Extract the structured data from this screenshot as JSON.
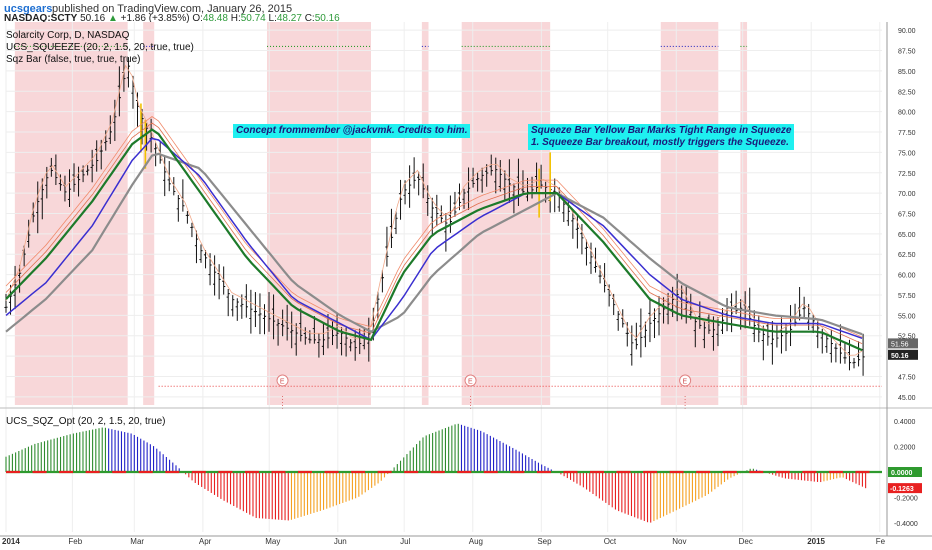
{
  "header": {
    "publisher": "ucsgears",
    "published_text": "published on TradingView.com, January 26, 2015"
  },
  "quote": {
    "symbol": "NASDAQ:SCTY",
    "last": "50.16",
    "arrow": "▲",
    "change": "+1.86 (+3.85%)",
    "o_label": "O:",
    "o": "48.48",
    "h_label": "H:",
    "h": "50.74",
    "l_label": "L:",
    "l": "48.27",
    "c_label": "C:",
    "c": "50.16"
  },
  "overlays": {
    "title": "Solarcity Corp, D, NASDAQ",
    "indicator1": "UCS_SQUEEZE (20, 2, 1.5, 20, true, true)",
    "indicator2": "Sqz Bar (false, true, true, true)",
    "indicator3": "UCS_SQZ_Opt (20, 2, 1.5, 20, true)"
  },
  "annotations": {
    "a1": "Concept frommember @jackvmk. Credits to him.",
    "a2": "Squeeze Bar Yellow Bar Marks Tight Range in Squeeze\n1. Squeeze Bar breakout, mostly triggers the Squeeze."
  },
  "colors": {
    "squeeze_band": "#f8d7d9",
    "ema_green": "#1d7a2a",
    "ema_blue": "#3a2fd0",
    "ema_gray": "#8c8c8c",
    "osc_green": "#2e8b2e",
    "osc_blue": "#2020c8",
    "osc_red": "#e82020",
    "osc_orange": "#f5a020",
    "last_price_bg": "#222222",
    "mom_label_bg": "#2e9a2e",
    "neg_label_bg": "#e82020"
  },
  "chart_data": {
    "type": "candlestick",
    "y_ticks": [
      "90.00",
      "87.50",
      "85.00",
      "82.50",
      "80.00",
      "77.50",
      "75.00",
      "72.50",
      "70.00",
      "67.50",
      "65.00",
      "62.50",
      "60.00",
      "57.50",
      "55.00",
      "52.50",
      "50.00",
      "47.50",
      "45.00"
    ],
    "ylim": [
      44.0,
      91.0
    ],
    "x_ticks": [
      "2014",
      "Feb",
      "Mar",
      "Apr",
      "May",
      "Jun",
      "Jul",
      "Aug",
      "Sep",
      "Oct",
      "Nov",
      "Dec",
      "2015",
      "Fe"
    ],
    "last_price": "50.16",
    "prev_marker": "51.56",
    "squeeze_periods": [
      [
        "2014-01-06",
        "2014-02-26"
      ],
      [
        "2014-03-05",
        "2014-03-10"
      ],
      [
        "2014-04-30",
        "2014-06-16"
      ],
      [
        "2014-07-09",
        "2014-07-12"
      ],
      [
        "2014-07-27",
        "2014-09-05"
      ],
      [
        "2014-10-25",
        "2014-11-20"
      ],
      [
        "2014-11-30",
        "2014-12-03"
      ]
    ],
    "earnings_markers": [
      "2014-05-07",
      "2014-07-31",
      "2014-11-05"
    ],
    "close_path": [
      [
        "2014-01-02",
        56.0
      ],
      [
        "2014-01-08",
        60.0
      ],
      [
        "2014-01-15",
        68.0
      ],
      [
        "2014-01-22",
        73.0
      ],
      [
        "2014-01-29",
        70.0
      ],
      [
        "2014-02-05",
        72.0
      ],
      [
        "2014-02-12",
        74.0
      ],
      [
        "2014-02-19",
        78.0
      ],
      [
        "2014-02-26",
        86.0
      ],
      [
        "2014-03-03",
        80.0
      ],
      [
        "2014-03-10",
        76.0
      ],
      [
        "2014-03-17",
        71.0
      ],
      [
        "2014-03-24",
        68.0
      ],
      [
        "2014-03-31",
        63.0
      ],
      [
        "2014-04-07",
        60.0
      ],
      [
        "2014-04-14",
        57.0
      ],
      [
        "2014-04-21",
        56.0
      ],
      [
        "2014-04-28",
        55.0
      ],
      [
        "2014-05-05",
        54.0
      ],
      [
        "2014-05-12",
        53.0
      ],
      [
        "2014-05-19",
        52.0
      ],
      [
        "2014-05-26",
        52.0
      ],
      [
        "2014-06-02",
        53.0
      ],
      [
        "2014-06-09",
        51.0
      ],
      [
        "2014-06-16",
        53.0
      ],
      [
        "2014-06-23",
        62.0
      ],
      [
        "2014-06-30",
        70.0
      ],
      [
        "2014-07-07",
        72.0
      ],
      [
        "2014-07-14",
        68.0
      ],
      [
        "2014-07-21",
        66.0
      ],
      [
        "2014-07-28",
        70.0
      ],
      [
        "2014-08-04",
        72.0
      ],
      [
        "2014-08-11",
        73.0
      ],
      [
        "2014-08-18",
        71.0
      ],
      [
        "2014-08-25",
        70.0
      ],
      [
        "2014-09-01",
        71.0
      ],
      [
        "2014-09-08",
        70.0
      ],
      [
        "2014-09-15",
        67.0
      ],
      [
        "2014-09-22",
        63.0
      ],
      [
        "2014-09-29",
        59.0
      ],
      [
        "2014-10-06",
        55.0
      ],
      [
        "2014-10-13",
        51.0
      ],
      [
        "2014-10-20",
        54.0
      ],
      [
        "2014-10-27",
        56.0
      ],
      [
        "2014-11-03",
        58.0
      ],
      [
        "2014-11-10",
        54.0
      ],
      [
        "2014-11-17",
        53.0
      ],
      [
        "2014-11-24",
        55.0
      ],
      [
        "2014-12-01",
        56.0
      ],
      [
        "2014-12-08",
        53.0
      ],
      [
        "2014-12-15",
        52.0
      ],
      [
        "2014-12-22",
        53.0
      ],
      [
        "2014-12-29",
        56.0
      ],
      [
        "2015-01-05",
        53.0
      ],
      [
        "2015-01-12",
        51.0
      ],
      [
        "2015-01-19",
        49.0
      ],
      [
        "2015-01-26",
        50.16
      ]
    ],
    "ema_green": [
      [
        "2014-01-02",
        57
      ],
      [
        "2014-01-20",
        62
      ],
      [
        "2014-02-10",
        69
      ],
      [
        "2014-02-28",
        76
      ],
      [
        "2014-03-10",
        78
      ],
      [
        "2014-03-31",
        70
      ],
      [
        "2014-04-21",
        62
      ],
      [
        "2014-05-12",
        56
      ],
      [
        "2014-06-02",
        53
      ],
      [
        "2014-06-16",
        52
      ],
      [
        "2014-06-30",
        60
      ],
      [
        "2014-07-14",
        65
      ],
      [
        "2014-08-04",
        68
      ],
      [
        "2014-08-25",
        70
      ],
      [
        "2014-09-08",
        70
      ],
      [
        "2014-09-29",
        64
      ],
      [
        "2014-10-20",
        57
      ],
      [
        "2014-11-03",
        55
      ],
      [
        "2014-11-24",
        54
      ],
      [
        "2014-12-15",
        53
      ],
      [
        "2015-01-05",
        53
      ],
      [
        "2015-01-26",
        50.5
      ]
    ],
    "ema_blue": [
      [
        "2014-01-02",
        55
      ],
      [
        "2014-01-20",
        59
      ],
      [
        "2014-02-10",
        66
      ],
      [
        "2014-02-28",
        74
      ],
      [
        "2014-03-10",
        77
      ],
      [
        "2014-03-31",
        72
      ],
      [
        "2014-04-21",
        64
      ],
      [
        "2014-05-12",
        57
      ],
      [
        "2014-06-02",
        54
      ],
      [
        "2014-06-16",
        52
      ],
      [
        "2014-06-30",
        57
      ],
      [
        "2014-07-14",
        63
      ],
      [
        "2014-08-04",
        67
      ],
      [
        "2014-08-25",
        70
      ],
      [
        "2014-09-08",
        70
      ],
      [
        "2014-09-29",
        66
      ],
      [
        "2014-10-20",
        60
      ],
      [
        "2014-11-03",
        57
      ],
      [
        "2014-11-24",
        55
      ],
      [
        "2014-12-15",
        54
      ],
      [
        "2015-01-05",
        54
      ],
      [
        "2015-01-26",
        52
      ]
    ],
    "ema_gray": [
      [
        "2014-01-02",
        53
      ],
      [
        "2014-01-20",
        57
      ],
      [
        "2014-02-10",
        63
      ],
      [
        "2014-02-28",
        71
      ],
      [
        "2014-03-10",
        75
      ],
      [
        "2014-03-31",
        73
      ],
      [
        "2014-04-21",
        66
      ],
      [
        "2014-05-12",
        59
      ],
      [
        "2014-06-02",
        55
      ],
      [
        "2014-06-16",
        53
      ],
      [
        "2014-06-30",
        55
      ],
      [
        "2014-07-14",
        60
      ],
      [
        "2014-08-04",
        65
      ],
      [
        "2014-08-25",
        68
      ],
      [
        "2014-09-08",
        70
      ],
      [
        "2014-09-29",
        67
      ],
      [
        "2014-10-20",
        62
      ],
      [
        "2014-11-03",
        59
      ],
      [
        "2014-11-24",
        56
      ],
      [
        "2014-12-15",
        55
      ],
      [
        "2015-01-05",
        54.5
      ],
      [
        "2015-01-26",
        52.5
      ]
    ],
    "momentum": {
      "y_ticks": [
        "0.4000",
        "0.2000",
        "-0.2000",
        "-0.4000"
      ],
      "ylim": [
        -0.47,
        0.47
      ],
      "current": "0.0000",
      "last_value": "-0.1263",
      "path": [
        [
          "2014-01-02",
          0.12
        ],
        [
          "2014-01-15",
          0.22
        ],
        [
          "2014-02-01",
          0.3
        ],
        [
          "2014-02-15",
          0.35
        ],
        [
          "2014-02-28",
          0.3
        ],
        [
          "2014-03-10",
          0.2
        ],
        [
          "2014-03-20",
          0.05
        ],
        [
          "2014-03-28",
          -0.08
        ],
        [
          "2014-04-10",
          -0.22
        ],
        [
          "2014-04-25",
          -0.36
        ],
        [
          "2014-05-10",
          -0.38
        ],
        [
          "2014-05-25",
          -0.3
        ],
        [
          "2014-06-10",
          -0.2
        ],
        [
          "2014-06-20",
          -0.08
        ],
        [
          "2014-06-30",
          0.1
        ],
        [
          "2014-07-10",
          0.28
        ],
        [
          "2014-07-25",
          0.38
        ],
        [
          "2014-08-05",
          0.32
        ],
        [
          "2014-08-20",
          0.18
        ],
        [
          "2014-09-01",
          0.06
        ],
        [
          "2014-09-10",
          -0.02
        ],
        [
          "2014-09-20",
          -0.12
        ],
        [
          "2014-10-05",
          -0.3
        ],
        [
          "2014-10-20",
          -0.4
        ],
        [
          "2014-11-01",
          -0.3
        ],
        [
          "2014-11-15",
          -0.18
        ],
        [
          "2014-11-25",
          -0.05
        ],
        [
          "2014-12-05",
          0.03
        ],
        [
          "2014-12-20",
          -0.05
        ],
        [
          "2015-01-05",
          -0.08
        ],
        [
          "2015-01-15",
          -0.04
        ],
        [
          "2015-01-26",
          -0.13
        ]
      ]
    }
  }
}
